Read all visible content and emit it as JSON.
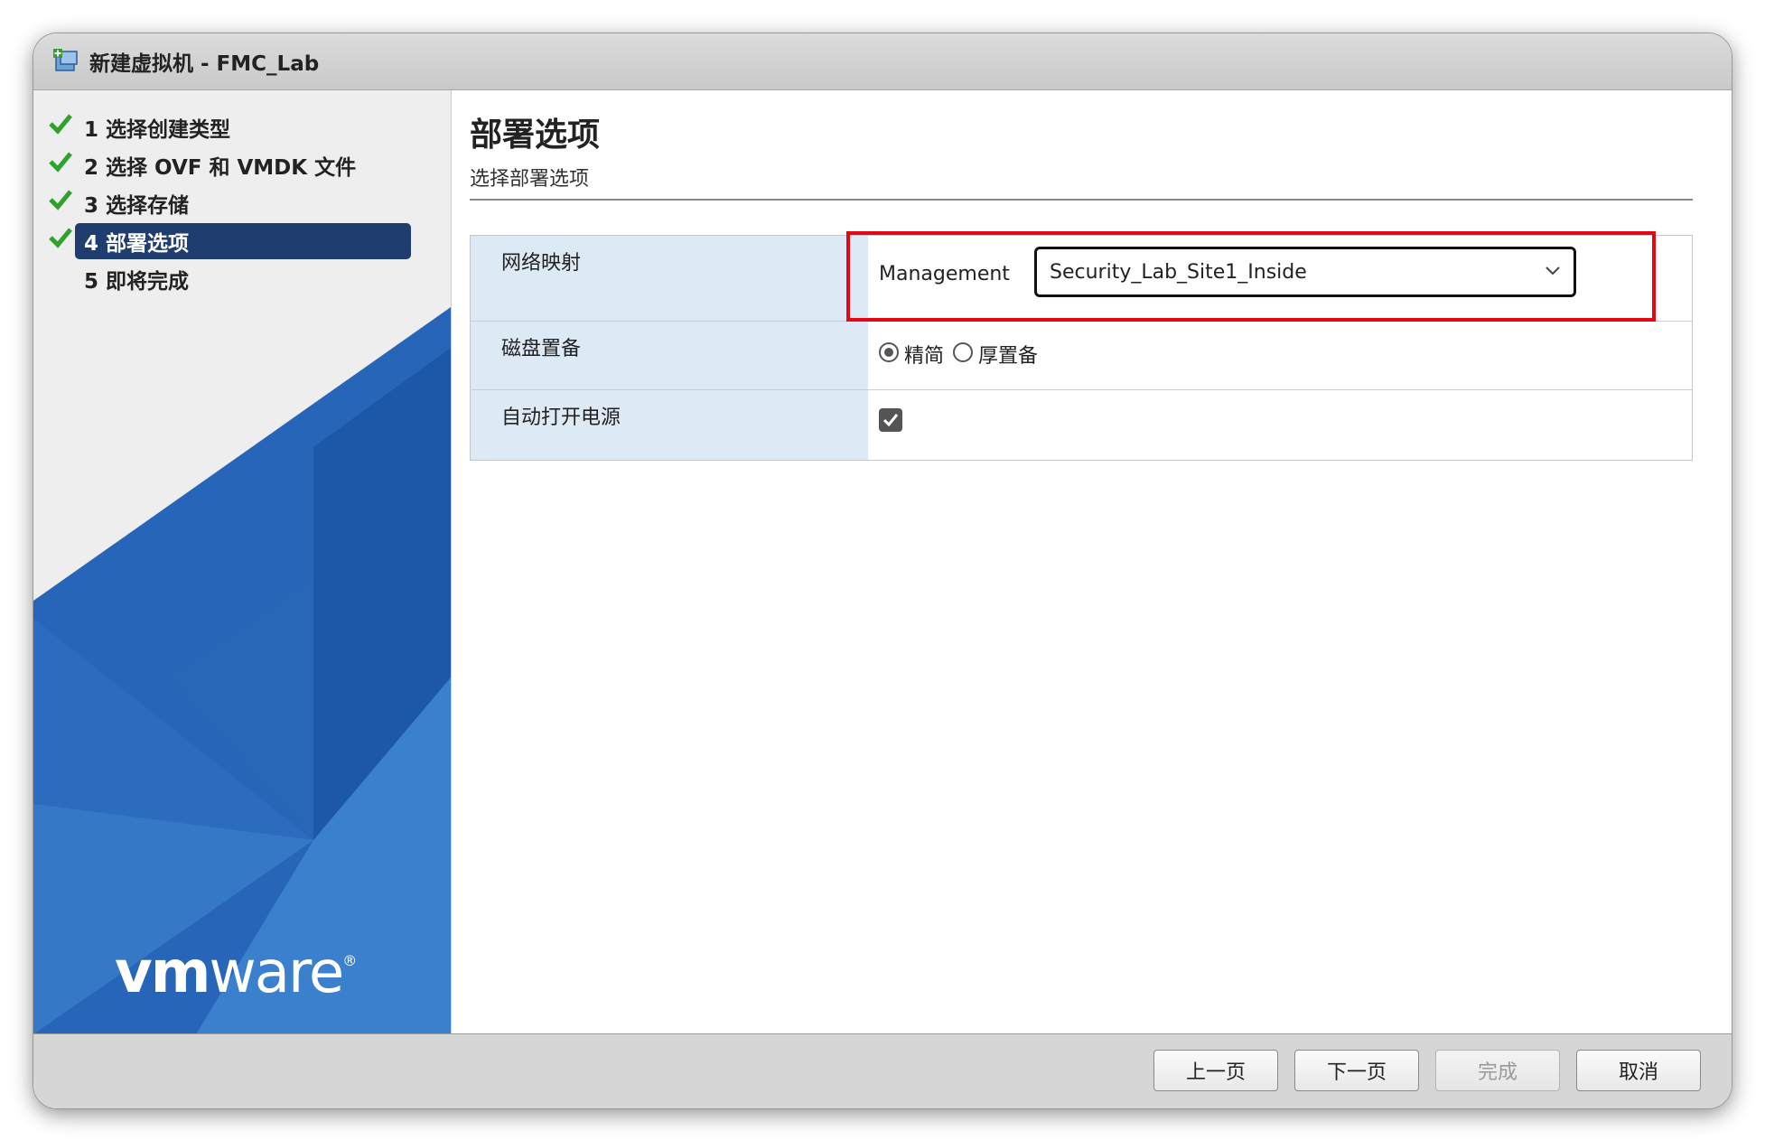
{
  "window": {
    "title": "新建虚拟机 - FMC_Lab",
    "icon": "new-vm-icon"
  },
  "wizard": {
    "steps": [
      {
        "label": "1 选择创建类型",
        "completed": true,
        "active": false
      },
      {
        "label": "2 选择 OVF 和 VMDK 文件",
        "completed": true,
        "active": false
      },
      {
        "label": "3 选择存储",
        "completed": true,
        "active": false
      },
      {
        "label": "4 部署选项",
        "completed": true,
        "active": true
      },
      {
        "label": "5 即将完成",
        "completed": false,
        "active": false
      }
    ]
  },
  "brand": {
    "logo_text_bold": "vm",
    "logo_text_light": "ware",
    "logo_mark": "®"
  },
  "main": {
    "title": "部署选项",
    "subtitle": "选择部署选项",
    "options": {
      "network_mapping": {
        "label": "网络映射",
        "source_network": "Management",
        "selected_network": "Security_Lab_Site1_Inside"
      },
      "disk_provisioning": {
        "label": "磁盘置备",
        "choices": [
          {
            "label": "精简",
            "selected": true
          },
          {
            "label": "厚置备",
            "selected": false
          }
        ]
      },
      "power_on": {
        "label": "自动打开电源",
        "checked": true
      }
    }
  },
  "footer": {
    "back_label": "上一页",
    "next_label": "下一页",
    "finish_label": "完成",
    "cancel_label": "取消",
    "finish_enabled": false
  },
  "colors": {
    "active_step": "#1f3d6e",
    "check_green": "#2fa12f",
    "highlight_red": "#e30613",
    "panel_blue": "#dde9f4",
    "vmware_blue_dark": "#1f5aa5",
    "vmware_blue_light": "#3f86cf"
  }
}
